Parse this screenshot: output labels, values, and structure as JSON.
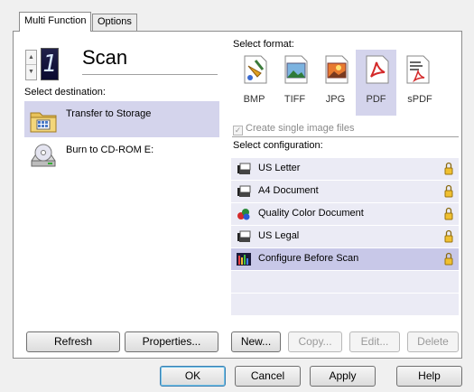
{
  "tabs": [
    {
      "label": "Multi Function"
    },
    {
      "label": "Options"
    }
  ],
  "scan": {
    "number": "1",
    "title": "Scan"
  },
  "destination": {
    "label": "Select destination:",
    "items": [
      {
        "label": "Transfer to Storage",
        "icon": "folder-grid-icon"
      },
      {
        "label": "Burn to CD-ROM  E:",
        "icon": "cd-drive-icon"
      }
    ]
  },
  "format": {
    "label": "Select format:",
    "items": [
      {
        "label": "BMP",
        "icon": "bmp-paint-icon"
      },
      {
        "label": "TIFF",
        "icon": "tiff-image-icon"
      },
      {
        "label": "JPG",
        "icon": "jpg-image-icon"
      },
      {
        "label": "PDF",
        "icon": "pdf-icon"
      },
      {
        "label": "sPDF",
        "icon": "spdf-icon"
      }
    ],
    "checkbox_label": "Create single image files"
  },
  "configuration": {
    "label": "Select configuration:",
    "items": [
      {
        "label": "US Letter",
        "icon": "scanner-icon"
      },
      {
        "label": "A4 Document",
        "icon": "scanner-icon"
      },
      {
        "label": "Quality Color Document",
        "icon": "color-drops-icon"
      },
      {
        "label": "US Legal",
        "icon": "scanner-icon"
      },
      {
        "label": "Configure Before Scan",
        "icon": "configure-bars-icon"
      }
    ]
  },
  "buttons": {
    "refresh": "Refresh",
    "properties": "Properties...",
    "new": "New...",
    "copy": "Copy...",
    "edit": "Edit...",
    "delete": "Delete",
    "ok": "OK",
    "cancel": "Cancel",
    "apply": "Apply",
    "help": "Help"
  },
  "colors": {
    "selection": "#d4d4ec",
    "config_row": "#ebebf5",
    "config_selected": "#c8c8e8"
  }
}
